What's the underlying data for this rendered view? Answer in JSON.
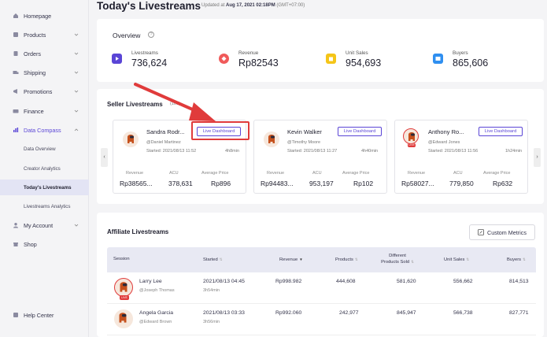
{
  "sidebar": {
    "items": [
      {
        "label": "Homepage",
        "icon": "home-icon"
      },
      {
        "label": "Products",
        "icon": "products-icon"
      },
      {
        "label": "Orders",
        "icon": "orders-icon"
      },
      {
        "label": "Shipping",
        "icon": "shipping-icon"
      },
      {
        "label": "Promotions",
        "icon": "promotions-icon"
      },
      {
        "label": "Finance",
        "icon": "finance-icon"
      },
      {
        "label": "Data Compass",
        "icon": "data-compass-icon"
      },
      {
        "label": "My Account",
        "icon": "account-icon"
      },
      {
        "label": "Shop",
        "icon": "shop-icon"
      },
      {
        "label": "Help Center",
        "icon": "help-center-icon"
      }
    ],
    "sub_items": [
      {
        "label": "Data Overview"
      },
      {
        "label": "Creator Analytics"
      },
      {
        "label": "Today's Livestreams"
      },
      {
        "label": "Livestreams Analytics"
      }
    ]
  },
  "header": {
    "title": "Today's Livestreams",
    "updated_prefix": "Updated at ",
    "updated_time": "Aug 17, 2021 02:18PM",
    "updated_tz": " (GMT+07:00)"
  },
  "overview": {
    "title": "Overview",
    "metrics": [
      {
        "label": "Livestreams",
        "value": "736,624",
        "icon": "livestream-icon",
        "color": "#5a45d6"
      },
      {
        "label": "Revenue",
        "value": "Rp82543",
        "icon": "revenue-icon",
        "color": "#f05a5a"
      },
      {
        "label": "Unit Sales",
        "value": "954,693",
        "icon": "unit-sales-icon",
        "color": "#f5c518"
      },
      {
        "label": "Buyers",
        "value": "865,606",
        "icon": "buyers-icon",
        "color": "#2f8ff0"
      }
    ]
  },
  "seller": {
    "title": "Seller Livestreams",
    "count": "(100)",
    "live_button": "Live Dashboard",
    "stat_labels": {
      "revenue": "Revenue",
      "acu": "ACU",
      "avg_price": "Average Price"
    },
    "cards": [
      {
        "name": "Sandra Rodr...",
        "handle": "@Daniel Martinez",
        "started": "Started: 2021/08/13 11:52",
        "duration": "4h8min",
        "revenue": "Rp38565...",
        "acu": "378,631",
        "avg_price": "Rp896",
        "live": false
      },
      {
        "name": "Kevin Walker",
        "handle": "@Timothy Moore",
        "started": "Started: 2021/08/13 11:27",
        "duration": "4h40min",
        "revenue": "Rp94483...",
        "acu": "953,197",
        "avg_price": "Rp102",
        "live": false
      },
      {
        "name": "Anthony Ro...",
        "handle": "@Edward Jones",
        "started": "Started: 2021/08/13 11:56",
        "duration": "1h24min",
        "revenue": "Rp58027...",
        "acu": "779,850",
        "avg_price": "Rp632",
        "live": true
      }
    ]
  },
  "affiliate": {
    "title": "Affiliate Livestreams",
    "custom_metrics": "Custom Metrics",
    "columns": [
      "Session",
      "Started",
      "Revenue",
      "Products",
      "Different Products Sold",
      "Unit Sales",
      "Buyers"
    ],
    "rows": [
      {
        "name": "Larry Lee",
        "handle": "@Joseph Thomas",
        "started": "2021/08/13 04:45",
        "duration": "3h54min",
        "revenue": "Rp998.982",
        "products": "444,608",
        "different": "581,620",
        "unit_sales": "556,662",
        "buyers": "814,513",
        "live": true
      },
      {
        "name": "Angela Garcia",
        "handle": "@Edward Brown",
        "started": "2021/08/13 03:33",
        "duration": "3h56min",
        "revenue": "Rp992.060",
        "products": "242,977",
        "different": "845,947",
        "unit_sales": "566,738",
        "buyers": "827,771",
        "live": false
      }
    ]
  },
  "live_badge": "LIVE",
  "colors": {
    "accent": "#5a45d6",
    "annotation": "#e03b3b"
  }
}
